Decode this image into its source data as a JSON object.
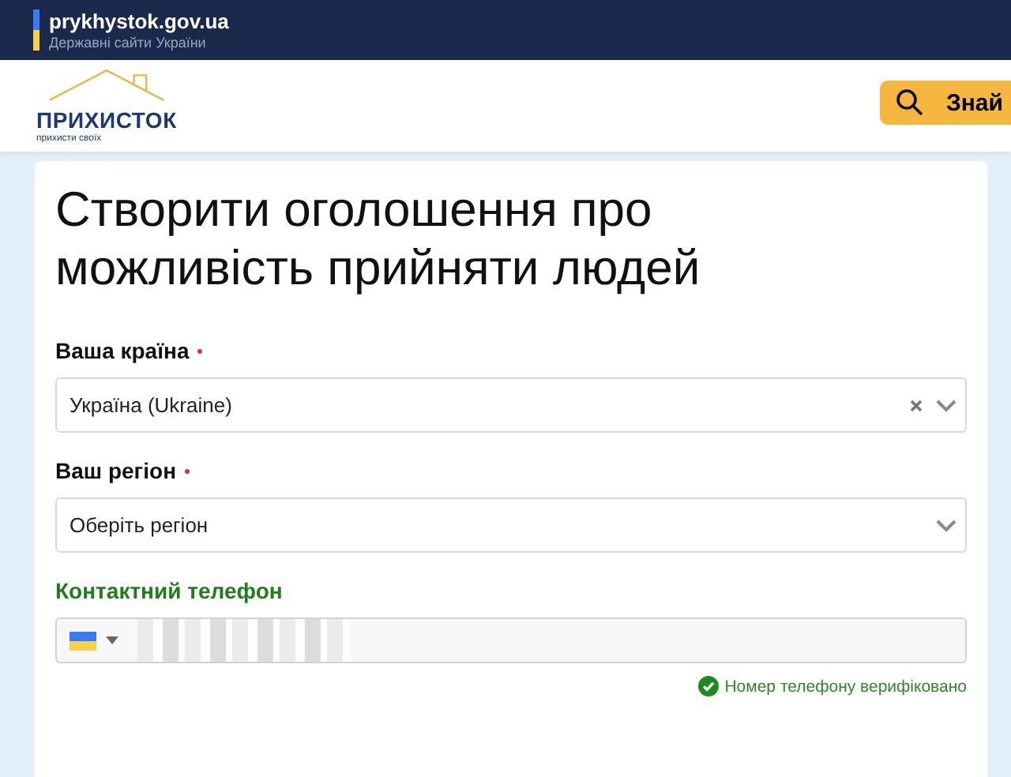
{
  "gov_bar": {
    "domain": "prykhystok.gov.ua",
    "subtitle": "Державні сайти України"
  },
  "header": {
    "logo_text": "ПРИХИСТОК",
    "logo_tagline": "прихисти своїх",
    "search_button": "Знай"
  },
  "form": {
    "title": "Створити оголошення про можливість прийняти людей",
    "fields": [
      {
        "kind": "select",
        "label": "Ваша країна",
        "required": true,
        "value": "Україна (Ukraine)",
        "clearable": true
      },
      {
        "kind": "select",
        "label": "Ваш регіон",
        "required": true,
        "placeholder": "Оберіть регіон",
        "clearable": false
      },
      {
        "kind": "phone",
        "label": "Контактний телефон",
        "required": false,
        "verified": true,
        "note": "Номер телефону верифіковано"
      }
    ]
  }
}
